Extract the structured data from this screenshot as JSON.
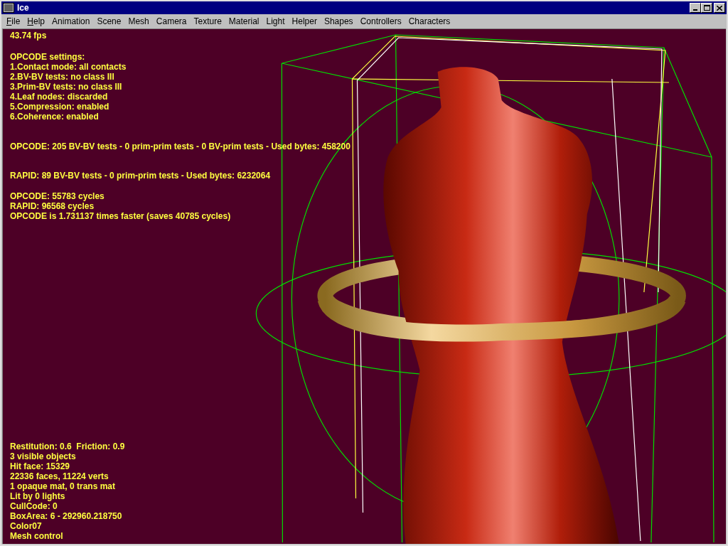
{
  "window": {
    "title": "Ice"
  },
  "menu": [
    {
      "label": "File",
      "mnemonic": true
    },
    {
      "label": "Help",
      "mnemonic": true
    },
    {
      "label": "Animation",
      "mnemonic": false
    },
    {
      "label": "Scene",
      "mnemonic": false
    },
    {
      "label": "Mesh",
      "mnemonic": false
    },
    {
      "label": "Camera",
      "mnemonic": false
    },
    {
      "label": "Texture",
      "mnemonic": false
    },
    {
      "label": "Material",
      "mnemonic": false
    },
    {
      "label": "Light",
      "mnemonic": false
    },
    {
      "label": "Helper",
      "mnemonic": false
    },
    {
      "label": "Shapes",
      "mnemonic": false
    },
    {
      "label": "Controllers",
      "mnemonic": false
    },
    {
      "label": "Characters",
      "mnemonic": false
    }
  ],
  "hud_top": [
    [
      "43.74 fps"
    ],
    [
      "OPCODE settings:",
      "1.Contact mode: all contacts",
      "2.BV-BV tests: no class III",
      "3.Prim-BV tests: no class III",
      "4.Leaf nodes: discarded",
      "5.Compression: enabled",
      "6.Coherence: enabled"
    ],
    [
      "OPCODE: 205 BV-BV tests - 0 prim-prim tests - 0 BV-prim tests - Used bytes: 458200"
    ],
    [
      "RAPID: 89 BV-BV tests - 0 prim-prim tests - Used bytes: 6232064"
    ],
    [
      "OPCODE: 55783 cycles",
      "RAPID: 96568 cycles",
      "OPCODE is 1.731137 times faster (saves 40785 cycles)"
    ]
  ],
  "hud_bottom": [
    "Restitution: 0.6  Friction: 0.9",
    "3 visible objects",
    "Hit face: 15329",
    "22336 faces, 11224 verts",
    "1 opaque mat, 0 trans mat",
    "Lit by 0 lights",
    "CullCode: 0",
    "BoxArea: 6 - 292960.218750",
    "Color07",
    "Mesh control"
  ]
}
